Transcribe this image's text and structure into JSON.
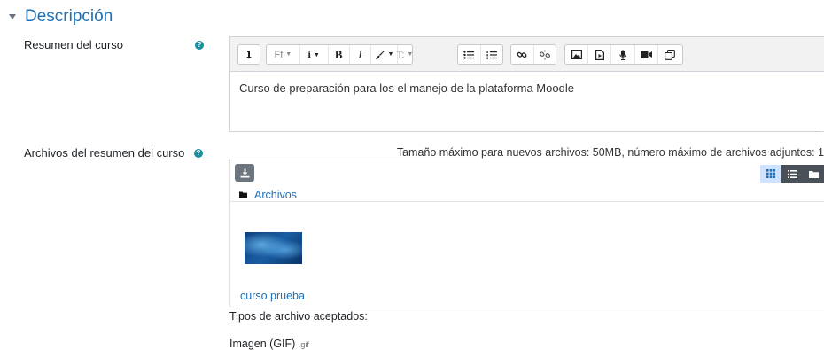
{
  "section": {
    "title": "Descripción"
  },
  "summary": {
    "label": "Resumen del curso",
    "content": "Curso de preparación para los el manejo de la plataforma Moodle"
  },
  "toolbar": {
    "paragraph_label": "Ff",
    "bold_label": "B",
    "italic_label": "I",
    "styles_label": "T:"
  },
  "files": {
    "label": "Archivos del resumen del curso",
    "limits": "Tamaño máximo para nuevos archivos: 50MB, número máximo de archivos adjuntos: 1",
    "breadcrumb": "Archivos",
    "file_name": "curso prueba",
    "accepted_label": "Tipos de archivo aceptados:",
    "accepted_type": "Imagen (GIF)",
    "accepted_ext": ".gif"
  },
  "colors": {
    "link": "#1f6fb5",
    "help": "#1a8fa0",
    "active_view": "#cfe2ff",
    "dark_btn": "#6c757d"
  }
}
